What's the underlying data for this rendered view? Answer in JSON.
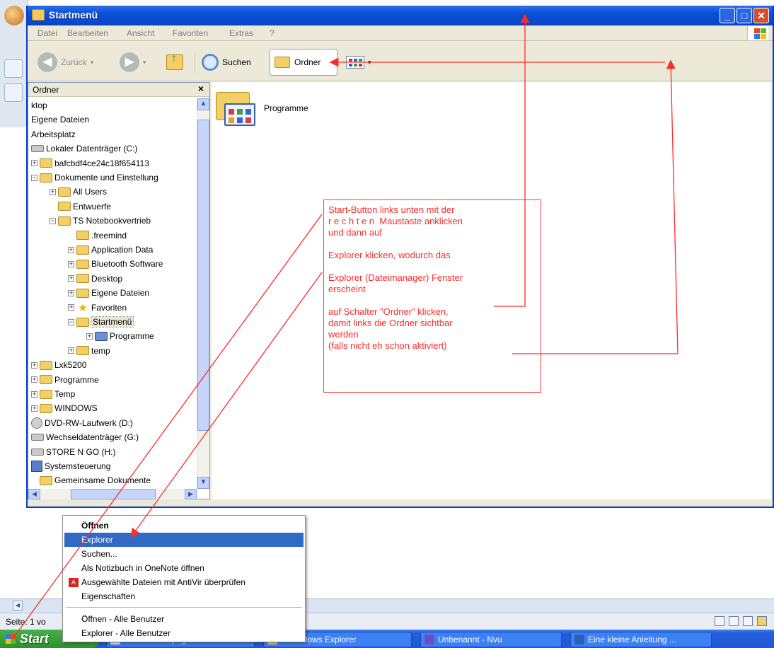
{
  "window": {
    "title": "Startmenü",
    "menu": [
      "Datei",
      "Bearbeiten",
      "Ansicht",
      "Favoriten",
      "Extras",
      "?"
    ],
    "toolbar": {
      "back_label": "Zurück",
      "search_label": "Suchen",
      "folders_label": "Ordner"
    }
  },
  "folder_pane": {
    "title": "Ordner",
    "close_glyph": "×",
    "tree": [
      {
        "label": "ktop",
        "icon": "none",
        "indent": 0,
        "expander": ""
      },
      {
        "label": "Eigene Dateien",
        "icon": "none",
        "indent": 0,
        "expander": ""
      },
      {
        "label": "Arbeitsplatz",
        "icon": "none",
        "indent": 0,
        "expander": ""
      },
      {
        "label": "Lokaler Datenträger (C:)",
        "icon": "drive",
        "indent": 0,
        "expander": ""
      },
      {
        "label": "bafcbdf4ce24c18f654113",
        "icon": "folder",
        "indent": 0,
        "expander": "+"
      },
      {
        "label": "Dokumente und Einstellung",
        "icon": "folder",
        "indent": 0,
        "expander": "−"
      },
      {
        "label": "All Users",
        "icon": "folder",
        "indent": 1,
        "expander": "+"
      },
      {
        "label": "Entwuerfe",
        "icon": "folder",
        "indent": 1,
        "expander": ""
      },
      {
        "label": "TS Notebookvertrieb",
        "icon": "folder",
        "indent": 1,
        "expander": "−"
      },
      {
        "label": ".freemind",
        "icon": "folder",
        "indent": 2,
        "expander": ""
      },
      {
        "label": "Application Data",
        "icon": "folder",
        "indent": 2,
        "expander": "+"
      },
      {
        "label": "Bluetooth Software",
        "icon": "folder",
        "indent": 2,
        "expander": "+"
      },
      {
        "label": "Desktop",
        "icon": "folder",
        "indent": 2,
        "expander": "+"
      },
      {
        "label": "Eigene Dateien",
        "icon": "folder",
        "indent": 2,
        "expander": "+"
      },
      {
        "label": "Favoriten",
        "icon": "star",
        "indent": 2,
        "expander": "+"
      },
      {
        "label": "Startmenü",
        "icon": "folder",
        "indent": 2,
        "expander": "−",
        "selected": true
      },
      {
        "label": "Programme",
        "icon": "progfolder",
        "indent": 3,
        "expander": "+"
      },
      {
        "label": "temp",
        "icon": "folder",
        "indent": 2,
        "expander": "+"
      },
      {
        "label": "Lxk5200",
        "icon": "folder",
        "indent": 0,
        "expander": "+"
      },
      {
        "label": "Programme",
        "icon": "folder",
        "indent": 0,
        "expander": "+"
      },
      {
        "label": "Temp",
        "icon": "folder",
        "indent": 0,
        "expander": "+"
      },
      {
        "label": "WINDOWS",
        "icon": "folder",
        "indent": 0,
        "expander": "+"
      },
      {
        "label": "DVD-RW-Laufwerk (D:)",
        "icon": "cd",
        "indent": 0,
        "expander": ""
      },
      {
        "label": "Wechseldatenträger (G:)",
        "icon": "drive",
        "indent": 0,
        "expander": ""
      },
      {
        "label": "STORE N GO (H:)",
        "icon": "drive",
        "indent": 0,
        "expander": ""
      },
      {
        "label": "Systemsteuerung",
        "icon": "control",
        "indent": 0,
        "expander": ""
      },
      {
        "label": "Gemeinsame Dokumente",
        "icon": "folder",
        "indent": 0,
        "expander": ""
      }
    ]
  },
  "content": {
    "item_label": "Programme"
  },
  "annotation": {
    "lines": [
      "Start-Button links unten mit der",
      "r e c h t e n  Maustaste anklicken",
      "und dann auf",
      "",
      "Explorer klicken, wodurch das",
      "",
      "Explorer (Dateimanager) Fenster",
      "erscheint",
      "",
      "auf Schalter \"Ordner\" klicken,",
      "damit links die Ordner sichtbar",
      "werden",
      "(falls nicht eh schon aktiviert)"
    ],
    "color": "#ff2a2a"
  },
  "context_menu": {
    "items": [
      {
        "label": "Öffnen",
        "bold": true
      },
      {
        "label": "Explorer",
        "highlighted": true
      },
      {
        "label": "Suchen..."
      },
      {
        "label": "Als Notizbuch in OneNote öffnen"
      },
      {
        "label": "Ausgewählte Dateien mit AntiVir überprüfen",
        "icon": "antivir-icon"
      },
      {
        "label": "Eigenschaften"
      },
      {
        "separator": true
      },
      {
        "label": "Öffnen - Alle Benutzer"
      },
      {
        "label": "Explorer - Alle Benutzer"
      }
    ]
  },
  "status": {
    "page_text": "Seite: 1 vo"
  },
  "taskbar": {
    "start_label": "Start",
    "tasks": [
      "Meine Homepage - Te...",
      "4 Windows Explorer",
      "Unbenannt - Nvu",
      "Eine kleine Anleitung ..."
    ]
  }
}
